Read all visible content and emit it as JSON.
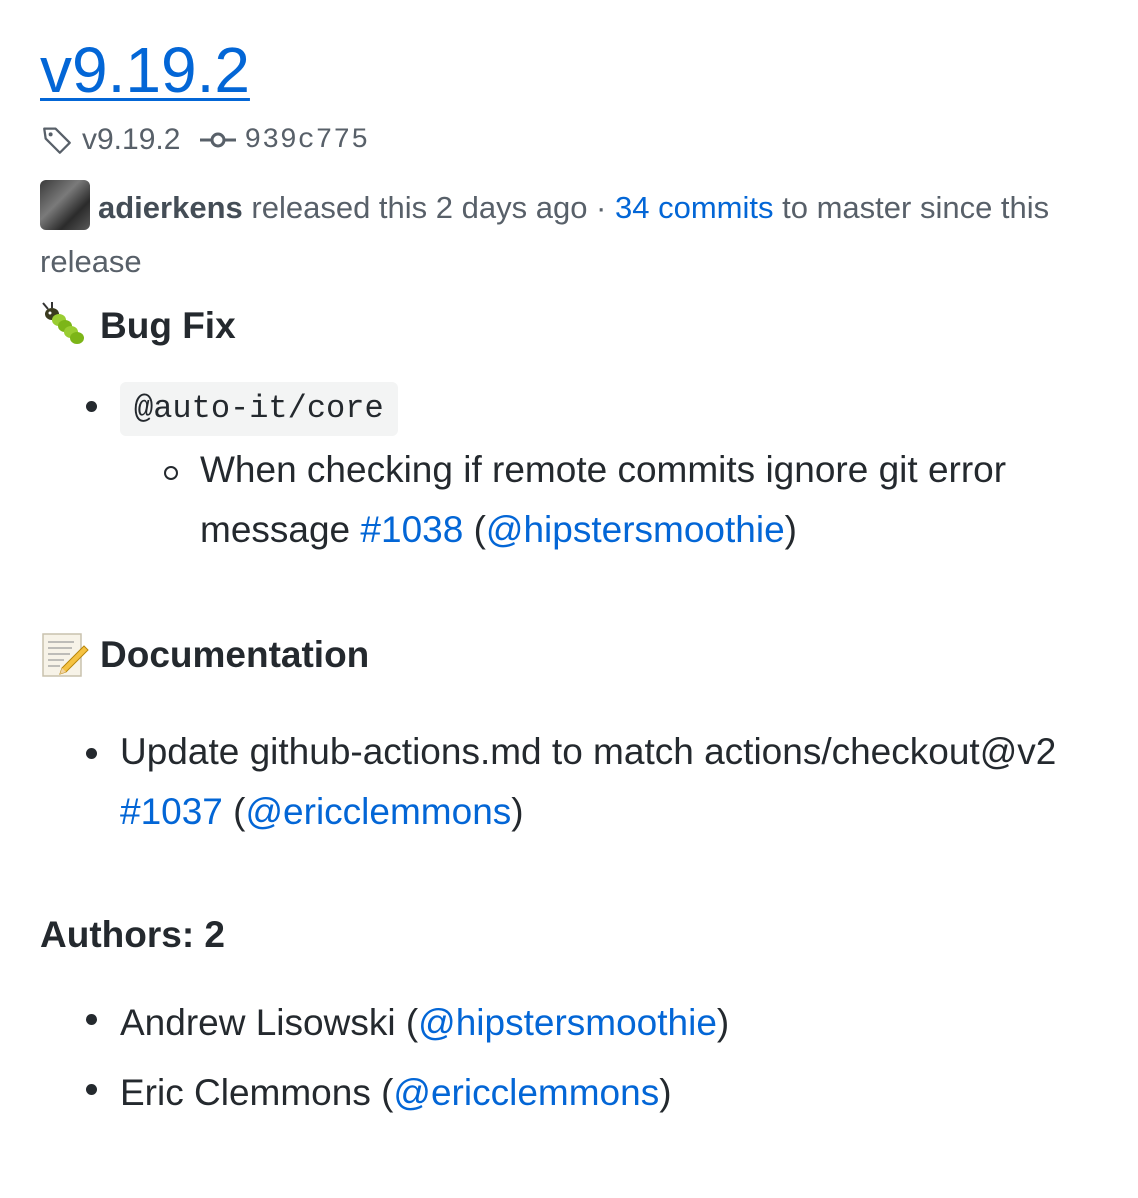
{
  "release": {
    "title": "v9.19.2",
    "tag": "v9.19.2",
    "commit": "939c775"
  },
  "byline": {
    "author": "adierkens",
    "released_text": "released this 2 days ago ·",
    "commits_link": "34 commits",
    "commits_suffix": "to master since this release"
  },
  "sections": {
    "bugfix": {
      "emoji": "bug-emoji",
      "title": "Bug Fix",
      "package": "@auto-it/core",
      "item_text": "When checking if remote commits ignore git error message",
      "pr": "#1038",
      "open_paren": "(",
      "user": "@hipstersmoothie",
      "close_paren": ")"
    },
    "docs": {
      "emoji": "memo-emoji",
      "title": "Documentation",
      "item_text": "Update github-actions.md to match actions/checkout@v2",
      "pr": "#1037",
      "open_paren": "(",
      "user": "@ericclemmons",
      "close_paren": ")"
    },
    "authors": {
      "title": "Authors: 2",
      "items": [
        {
          "name": "Andrew Lisowski (",
          "user": "@hipstersmoothie",
          "close": ")"
        },
        {
          "name": "Eric Clemmons (",
          "user": "@ericclemmons",
          "close": ")"
        }
      ]
    }
  },
  "colors": {
    "link": "#0366d6",
    "text": "#24292e",
    "muted": "#586069",
    "code_bg": "#f3f4f4"
  }
}
